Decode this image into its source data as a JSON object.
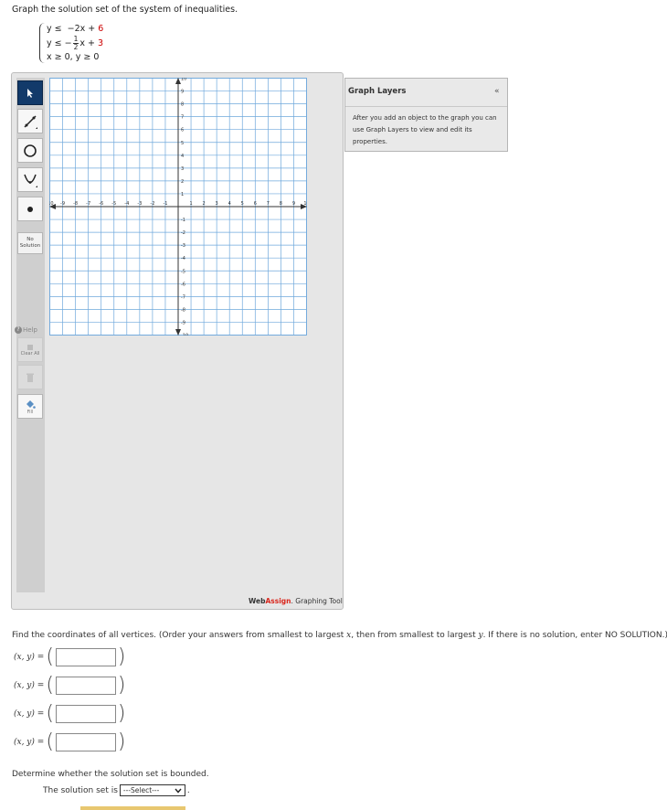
{
  "question": {
    "prompt": "Graph the solution set of the system of inequalities.",
    "ineq1": {
      "lhs": "y ≤",
      "mid": "−2x +",
      "const": "6"
    },
    "ineq2": {
      "lhs": "y ≤ −",
      "frac_num": "1",
      "frac_den": "2",
      "mid": "x +",
      "const": "3"
    },
    "ineq3": {
      "text": "x ≥  0,  y ≥  0"
    }
  },
  "colors": {
    "accent_red": "#cc0000",
    "active_tool": "#123a6a",
    "grid_line": "#6fa8dc",
    "highlight_tab": "#e8c770"
  },
  "tools": [
    {
      "name": "pointer",
      "icon": "pointer-arrow-icon",
      "active": true
    },
    {
      "name": "line",
      "icon": "line-ray-icon"
    },
    {
      "name": "circle",
      "icon": "circle-icon"
    },
    {
      "name": "parabola",
      "icon": "parabola-icon"
    },
    {
      "name": "point",
      "icon": "point-icon"
    }
  ],
  "no_solution_label_1": "No",
  "no_solution_label_2": "Solution",
  "help_label": "Help",
  "clear_all_label": "Clear All",
  "delete_icon": "trash-icon",
  "fill_label": "Fill",
  "graph": {
    "x_ticks": [
      "-10",
      "-9",
      "-8",
      "-7",
      "-6",
      "-5",
      "-4",
      "-3",
      "-2",
      "-1",
      "1",
      "2",
      "3",
      "4",
      "5",
      "6",
      "7",
      "8",
      "9",
      "10"
    ],
    "y_ticks": [
      "10",
      "9",
      "8",
      "7",
      "6",
      "5",
      "4",
      "3",
      "2",
      "1",
      "-1",
      "-2",
      "-3",
      "-4",
      "-5",
      "-6",
      "-7",
      "-8",
      "-9",
      "-10"
    ]
  },
  "layers": {
    "title": "Graph Layers",
    "collapse": "«",
    "message": "After you add an object to the graph you can use Graph Layers to view and edit its properties."
  },
  "brand": {
    "web": "Web",
    "assign": "Assign",
    "rest": ". Graphing Tool"
  },
  "vertices_prompt_a": "Find the coordinates of all vertices. (Order your answers from smallest to largest ",
  "vertices_prompt_x": "x",
  "vertices_prompt_b": ", then from smallest to largest ",
  "vertices_prompt_y": "y",
  "vertices_prompt_c": ". If there is no solution, enter NO SOLUTION.)",
  "answers": [
    {
      "label": "(x, y) =",
      "value": ""
    },
    {
      "label": "(x, y) =",
      "value": ""
    },
    {
      "label": "(x, y) =",
      "value": ""
    },
    {
      "label": "(x, y) =",
      "value": ""
    }
  ],
  "bounded": {
    "question": "Determine whether the solution set is bounded.",
    "lead": "The solution set is",
    "select_value": "---Select---",
    "trailing": "."
  }
}
